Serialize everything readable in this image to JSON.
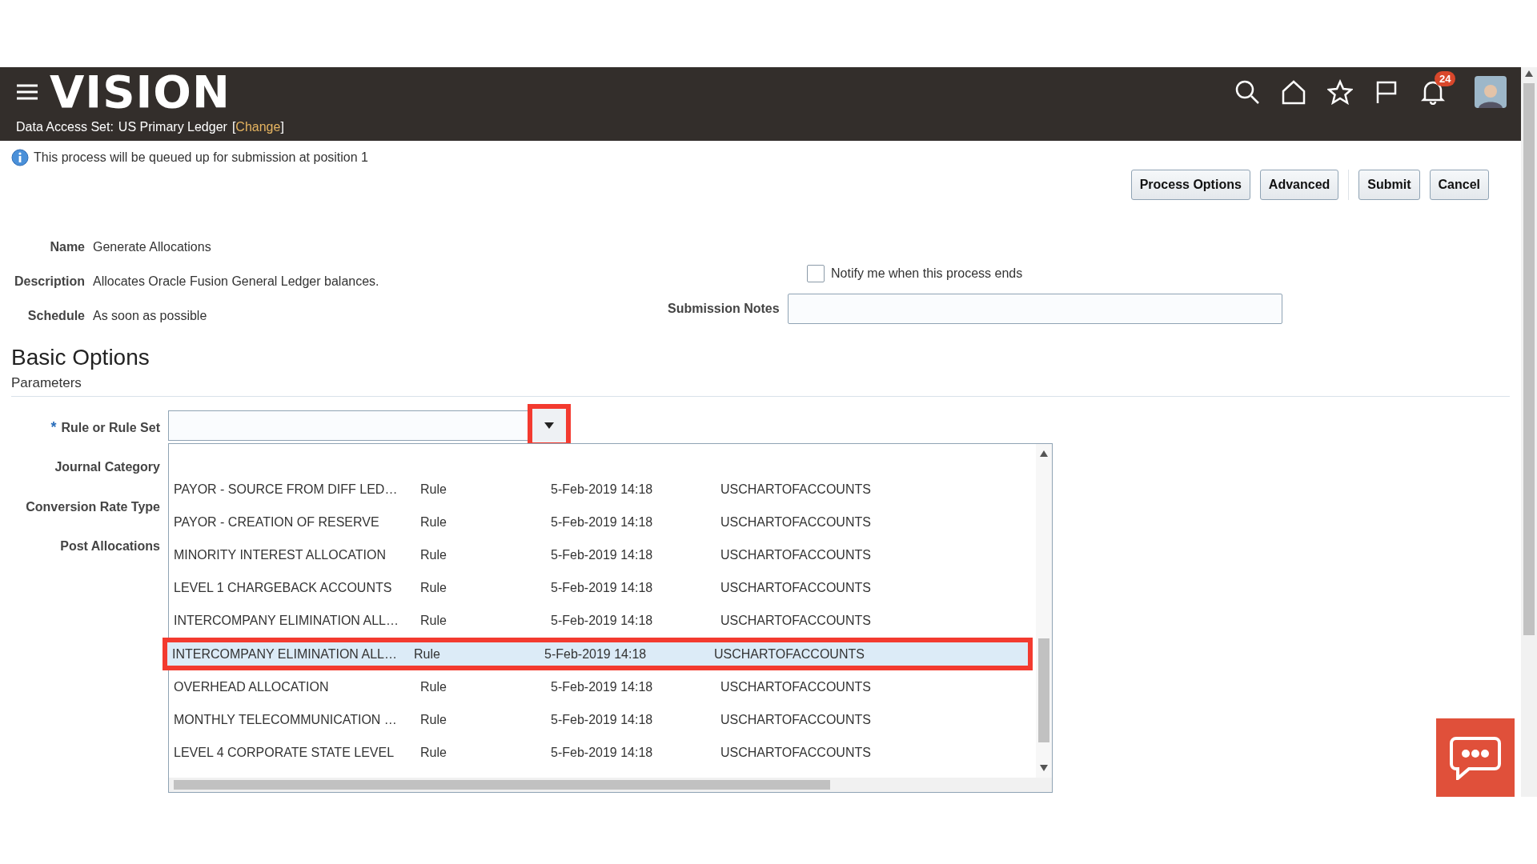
{
  "header": {
    "logo": "VISION",
    "data_access_label": "Data Access Set:",
    "data_access_value": "US Primary Ledger",
    "change_link": "Change",
    "bracket_open": "[",
    "bracket_close": "]",
    "notification_count": "24"
  },
  "info_message": "This process will be queued up for submission at position 1",
  "buttons": [
    {
      "label": "Process Options"
    },
    {
      "label": "Advanced"
    },
    {
      "label": "Submit"
    },
    {
      "label": "Cancel"
    }
  ],
  "details": [
    {
      "label": "Name",
      "value": "Generate Allocations"
    },
    {
      "label": "Description",
      "value": "Allocates Oracle Fusion General Ledger balances."
    },
    {
      "label": "Schedule",
      "value": "As soon as possible"
    }
  ],
  "notify": {
    "label": "Notify me when this process ends",
    "checked": false
  },
  "submission_notes": {
    "label": "Submission Notes"
  },
  "section_title": "Basic Options",
  "subsection_title": "Parameters",
  "parameters": [
    {
      "label": "Rule or Rule Set",
      "required_mark": "*"
    },
    {
      "label": "Journal Category"
    },
    {
      "label": "Conversion Rate Type"
    },
    {
      "label": "Post Allocations"
    }
  ],
  "dropdown": {
    "button_highlighted": true,
    "rows": [
      {
        "name": "PAYOR - SOURCE FROM DIFF LED…",
        "type": "Rule",
        "date": "5-Feb-2019 14:18",
        "chart": "USCHARTOFACCOUNTS",
        "selected": false
      },
      {
        "name": "PAYOR - CREATION OF RESERVE",
        "type": "Rule",
        "date": "5-Feb-2019 14:18",
        "chart": "USCHARTOFACCOUNTS",
        "selected": false
      },
      {
        "name": "MINORITY INTEREST ALLOCATION",
        "type": "Rule",
        "date": "5-Feb-2019 14:18",
        "chart": "USCHARTOFACCOUNTS",
        "selected": false
      },
      {
        "name": "LEVEL 1 CHARGEBACK ACCOUNTS",
        "type": "Rule",
        "date": "5-Feb-2019 14:18",
        "chart": "USCHARTOFACCOUNTS",
        "selected": false
      },
      {
        "name": "INTERCOMPANY ELIMINATION ALL…",
        "type": "Rule",
        "date": "5-Feb-2019 14:18",
        "chart": "USCHARTOFACCOUNTS",
        "selected": false
      },
      {
        "name": "INTERCOMPANY ELIMINATION ALL…",
        "type": "Rule",
        "date": "5-Feb-2019 14:18",
        "chart": "USCHARTOFACCOUNTS",
        "selected": true
      },
      {
        "name": "OVERHEAD ALLOCATION",
        "type": "Rule",
        "date": "5-Feb-2019 14:18",
        "chart": "USCHARTOFACCOUNTS",
        "selected": false
      },
      {
        "name": "MONTHLY TELECOMMUNICATION …",
        "type": "Rule",
        "date": "5-Feb-2019 14:18",
        "chart": "USCHARTOFACCOUNTS",
        "selected": false
      },
      {
        "name": "LEVEL 4 CORPORATE STATE LEVEL",
        "type": "Rule",
        "date": "5-Feb-2019 14:18",
        "chart": "USCHARTOFACCOUNTS",
        "selected": false
      }
    ]
  }
}
